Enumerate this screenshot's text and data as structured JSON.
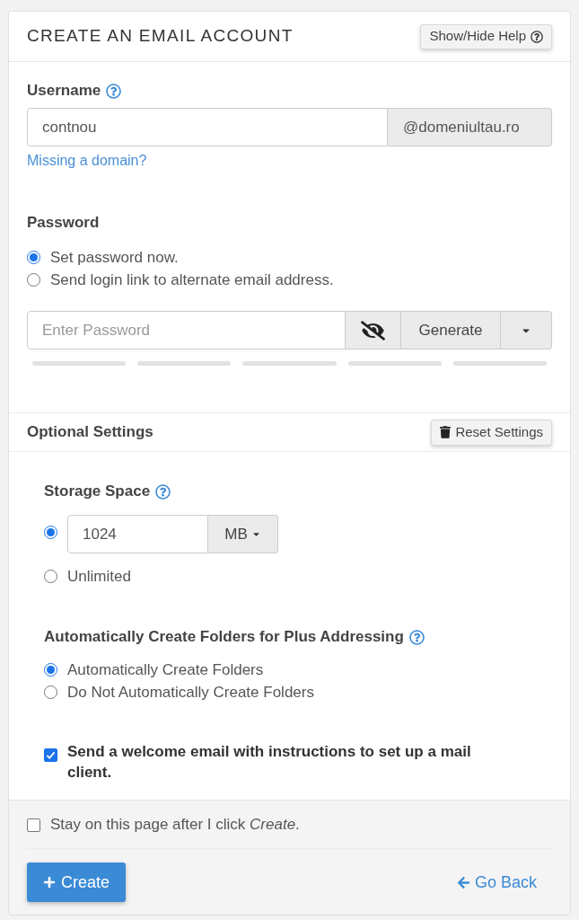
{
  "panel": {
    "title": "CREATE AN EMAIL ACCOUNT",
    "help_button": "Show/Hide Help"
  },
  "username": {
    "label": "Username",
    "value": "contnou",
    "domain": "@domeniultau.ro",
    "link": "Missing a domain?"
  },
  "password": {
    "label": "Password",
    "options": [
      {
        "label": "Set password now.",
        "selected": true
      },
      {
        "label": "Send login link to alternate email address.",
        "selected": false
      }
    ],
    "placeholder": "Enter Password",
    "generate_button": "Generate"
  },
  "optional_settings": {
    "title": "Optional Settings",
    "reset_button": "Reset Settings",
    "storage": {
      "label": "Storage Space",
      "options": [
        {
          "kind": "amount",
          "value": "1024",
          "unit": "MB",
          "selected": true
        },
        {
          "kind": "plain",
          "label": "Unlimited",
          "selected": false
        }
      ]
    },
    "plus_addressing": {
      "label": "Automatically Create Folders for Plus Addressing",
      "options": [
        {
          "label": "Automatically Create Folders",
          "selected": true
        },
        {
          "label": "Do Not Automatically Create Folders",
          "selected": false
        }
      ]
    },
    "welcome_email": {
      "label": "Send a welcome email with instructions to set up a mail client.",
      "checked": true
    }
  },
  "footer": {
    "stay_on_page": {
      "label": "Stay on this page after I click *Create*.",
      "checked": false
    },
    "create_button": "Create",
    "go_back_link": "Go Back"
  }
}
